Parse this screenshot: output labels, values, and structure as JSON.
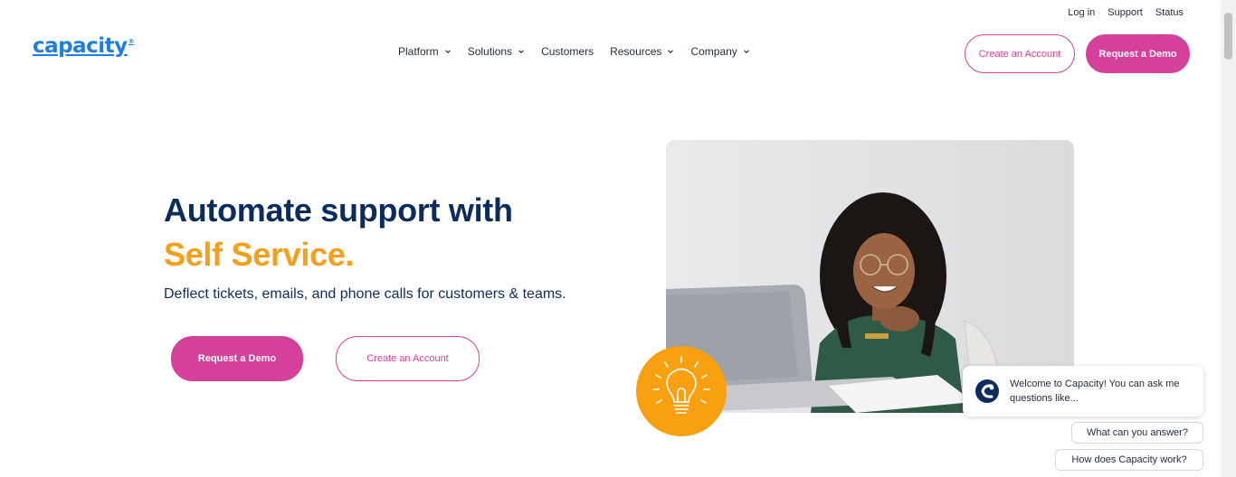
{
  "utility_nav": [
    "Log in",
    "Support",
    "Status"
  ],
  "logo": {
    "text": "capacity",
    "mark": "®"
  },
  "main_nav": [
    {
      "label": "Platform",
      "has_dropdown": true
    },
    {
      "label": "Solutions",
      "has_dropdown": true
    },
    {
      "label": "Customers",
      "has_dropdown": false
    },
    {
      "label": "Resources",
      "has_dropdown": true
    },
    {
      "label": "Company",
      "has_dropdown": true
    }
  ],
  "header": {
    "create_account": "Create an Account",
    "request_demo": "Request a Demo"
  },
  "hero": {
    "title": "Automate support with",
    "accent": "Self Service.",
    "subtitle": "Deflect tickets, emails, and phone calls for customers & teams.",
    "request_demo": "Request a Demo",
    "create_account": "Create an Account"
  },
  "chat": {
    "welcome": "Welcome to Capacity! You can ask me questions like...",
    "suggestions": [
      "What can you answer?",
      "How does Capacity work?"
    ]
  },
  "colors": {
    "brand_blue": "#1f7ee0",
    "navy": "#0d2c5e",
    "accent_orange": "#f59f1a",
    "cta_pink": "#d4409a",
    "bulb_orange": "#f8a010"
  },
  "icons": {
    "dropdown": "chevron-down-icon",
    "bulb": "lightbulb-icon",
    "chat_avatar": "capacity-chat-icon"
  }
}
